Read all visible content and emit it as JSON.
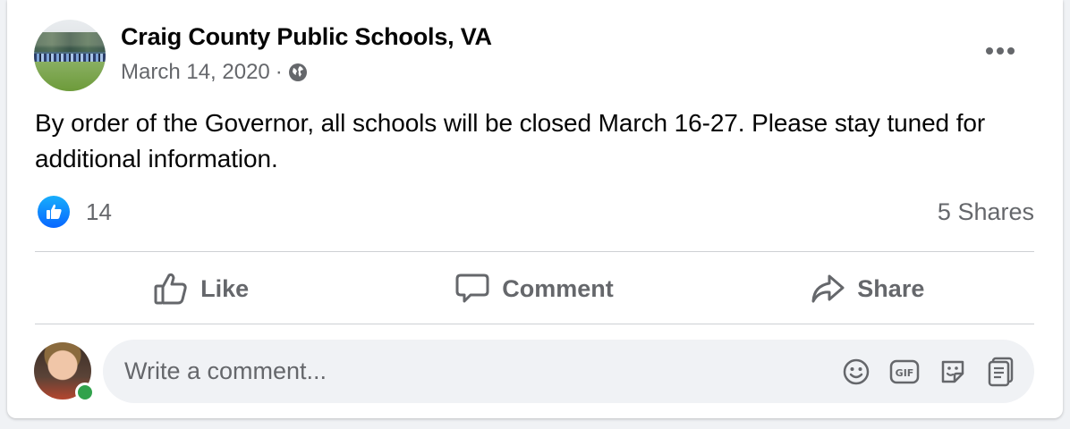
{
  "post": {
    "author": "Craig County Public Schools, VA",
    "date": "March 14, 2020",
    "separator": "·",
    "privacy_icon": "globe-icon",
    "more_icon": "more-options-icon",
    "text": "By order of the Governor, all schools will be closed March 16-27. Please stay tuned for additional information.",
    "reaction_icon": "like-reaction-icon",
    "reaction_count": "14",
    "shares": "5 Shares"
  },
  "actions": {
    "like": "Like",
    "comment": "Comment",
    "share": "Share"
  },
  "comment_input": {
    "placeholder": "Write a comment...",
    "icons": [
      "emoji-icon",
      "gif-icon",
      "sticker-icon",
      "avatar-sticker-icon"
    ]
  },
  "colors": {
    "accent": "#0866ff",
    "secondary_text": "#65676b",
    "online": "#31a24c"
  }
}
